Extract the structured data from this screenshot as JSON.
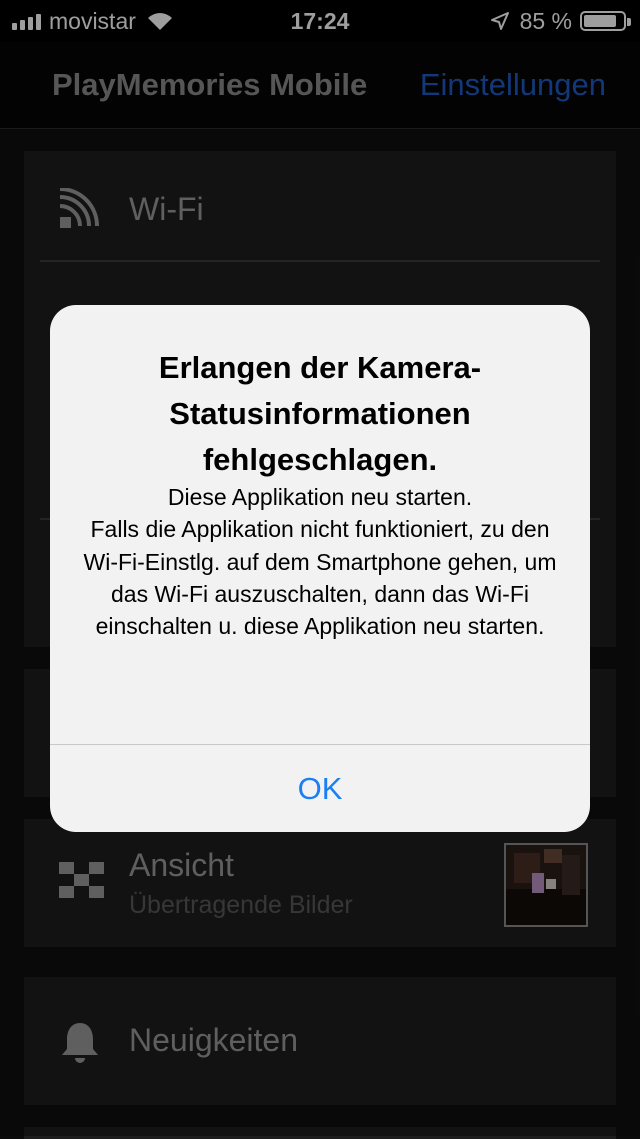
{
  "status_bar": {
    "carrier": "movistar",
    "time": "17:24",
    "battery_percent": "85 %",
    "battery_level": 0.85,
    "icons": [
      "signal-icon",
      "wifi-icon",
      "location-arrow-icon",
      "battery-icon"
    ]
  },
  "navbar": {
    "title": "PlayMemories Mobile",
    "settings_label": "Einstellungen"
  },
  "menu": {
    "wifi_label": "Wi-Fi",
    "ansicht_label": "Ansicht",
    "ansicht_subtitle": "Übertragende Bilder",
    "news_label": "Neuigkeiten"
  },
  "alert": {
    "title": "Erlangen der Kamera-Statusinformationen fehlgeschlagen.",
    "message": "Diese Applikation neu starten.\nFalls die Applikation nicht funktioniert, zu den Wi-Fi-Einstlg. auf dem Smartphone gehen, um das Wi-Fi auszuschalten, dann das Wi-Fi einschalten u. diese Applikation neu starten.",
    "ok_label": "OK"
  },
  "colors": {
    "accent_link": "#1e5bc4",
    "alert_button": "#1a7ff5",
    "alert_background": "#f2f2f2"
  }
}
